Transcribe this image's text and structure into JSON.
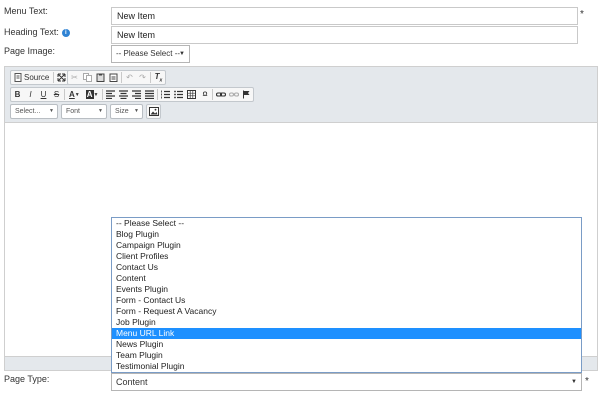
{
  "form": {
    "menu_text_label": "Menu Text:",
    "menu_text_value": "New Item",
    "heading_text_label": "Heading Text:",
    "heading_text_value": "New Item",
    "page_image_label": "Page Image:",
    "page_image_value": "-- Please Select --",
    "page_type_label": "Page Type:",
    "page_type_value": "Content",
    "required_mark": "*",
    "info_glyph": "i"
  },
  "editor": {
    "source_label": "Source",
    "format_combo": "Select...",
    "font_combo": "Font",
    "size_combo": "Size"
  },
  "dropdown": {
    "options": [
      "-- Please Select --",
      "Blog Plugin",
      "Campaign Plugin",
      "Client Profiles",
      "Contact Us",
      "Content",
      "Events Plugin",
      "Form - Contact Us",
      "Form - Request A Vacancy",
      "Job Plugin",
      "Menu URL Link",
      "News Plugin",
      "Team Plugin",
      "Testimonial Plugin"
    ],
    "highlighted": "Menu URL Link"
  },
  "colors": {
    "highlight": "#1e90ff",
    "info": "#2f83d4",
    "toolbar_bg": "#e4e8ec"
  },
  "icons": [
    "source-icon",
    "maximize-icon",
    "cut-icon",
    "copy-icon",
    "paste-icon",
    "paste-text-icon",
    "undo-icon",
    "redo-icon",
    "remove-format-icon",
    "bold-icon",
    "italic-icon",
    "underline-icon",
    "strikethrough-icon",
    "text-color-icon",
    "bg-color-icon",
    "align-left-icon",
    "align-center-icon",
    "align-right-icon",
    "justify-icon",
    "numbered-list-icon",
    "bulleted-list-icon",
    "table-icon",
    "special-char-icon",
    "link-icon",
    "unlink-icon",
    "anchor-icon",
    "image-icon"
  ]
}
